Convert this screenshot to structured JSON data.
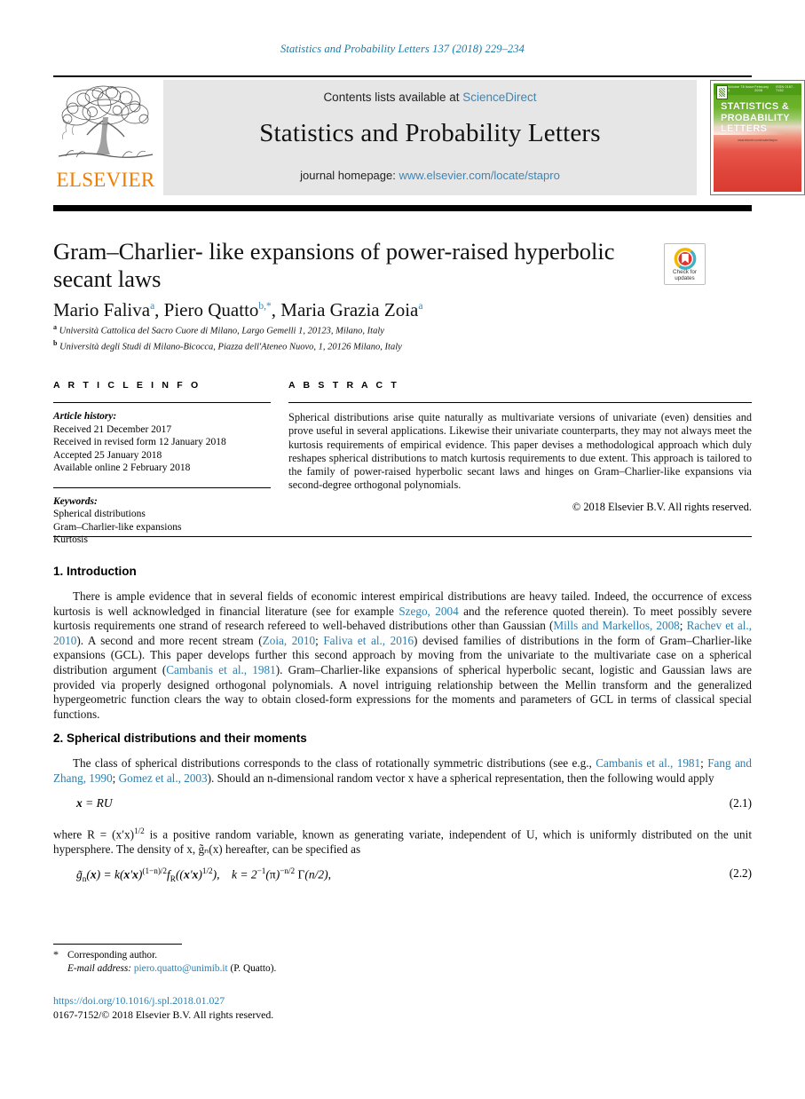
{
  "running_head": "Statistics and Probability Letters 137 (2018) 229–234",
  "header": {
    "contents_prefix": "Contents lists available at ",
    "sciencedirect": "ScienceDirect",
    "journal_title": "Statistics and Probability Letters",
    "homepage_prefix": "journal homepage: ",
    "homepage_url": "www.elsevier.com/locate/stapro",
    "publisher": "ELSEVIER",
    "cover": {
      "title_line1": "STATISTICS &",
      "title_line2": "PROBABILITY",
      "title_line3": "LETTERS",
      "top_left": "Volume 78 Issue 4",
      "top_mid": "February 2008",
      "top_right": "ISSN 0167-7152",
      "caption": "www.elsevier.com/locate/stapro"
    },
    "link_color": "#3d85b5",
    "brand_color": "#f07d00"
  },
  "article": {
    "title": "Gram–Charlier- like expansions of power-raised hyperbolic secant laws",
    "authors": [
      {
        "name": "Mario Faliva",
        "marks": "a"
      },
      {
        "name": "Piero Quatto",
        "marks": "b,*"
      },
      {
        "name": "Maria Grazia Zoia",
        "marks": "a"
      }
    ],
    "affiliations": [
      {
        "mark": "a",
        "text": "Università Cattolica del Sacro Cuore di Milano, Largo Gemelli 1, 20123, Milano, Italy"
      },
      {
        "mark": "b",
        "text": "Università degli Studi di Milano-Bicocca, Piazza dell'Ateneo Nuovo, 1, 20126 Milano, Italy"
      }
    ],
    "crossmark": {
      "line1": "Check for",
      "line2": "updates"
    }
  },
  "article_info": {
    "heading": "A R T I C L E   I N F O",
    "history_label": "Article history:",
    "history": [
      "Received 21 December 2017",
      "Received in revised form 12 January 2018",
      "Accepted 25 January 2018",
      "Available online 2 February 2018"
    ],
    "keywords_label": "Keywords:",
    "keywords": [
      "Spherical distributions",
      "Gram–Charlier-like expansions",
      "Kurtosis"
    ]
  },
  "abstract": {
    "heading": "A B S T R A C T",
    "text": "Spherical distributions arise quite naturally as multivariate versions of univariate (even) densities and prove useful in several applications. Likewise their univariate counterparts, they may not always meet the kurtosis requirements of empirical evidence. This paper devises a methodological approach which duly reshapes spherical distributions to match kurtosis requirements to due extent. This approach is tailored to the family of power-raised hyperbolic secant laws and hinges on Gram–Charlier-like expansions via second-degree orthogonal polynomials.",
    "copyright": "© 2018 Elsevier B.V. All rights reserved."
  },
  "sections": {
    "intro_heading": "1.  Introduction",
    "intro_p1_a": "There is ample evidence that in several fields of economic interest empirical distributions are heavy tailed. Indeed, the occurrence of excess kurtosis is well acknowledged in financial literature (see for example ",
    "intro_ref1": "Szego, 2004",
    "intro_p1_b": " and the reference quoted therein). To meet possibly severe kurtosis requirements one strand of research refereed to well-behaved distributions other than Gaussian (",
    "intro_ref2": "Mills and Markellos, 2008",
    "intro_p1_c": "; ",
    "intro_ref3": "Rachev et al., 2010",
    "intro_p1_d": "). A second and more recent stream (",
    "intro_ref4": "Zoia, 2010",
    "intro_p1_e": "; ",
    "intro_ref5": "Faliva et al., 2016",
    "intro_p1_f": ") devised families of distributions in the form of Gram–Charlier-like expansions (GCL). This paper develops further this second approach by moving from the univariate to the multivariate case on a spherical distribution argument (",
    "intro_ref6": "Cambanis et al., 1981",
    "intro_p1_g": "). Gram–Charlier-like expansions of spherical hyperbolic secant, logistic and Gaussian laws are provided via properly designed orthogonal polynomials. A novel intriguing relationship between the Mellin transform and the generalized hypergeometric function clears the way to obtain closed-form expressions for the moments and parameters of GCL in terms of classical special functions.",
    "sec2_heading": "2.  Spherical distributions and their moments",
    "sec2_p1_a": "The class of spherical distributions corresponds to the class of rotationally symmetric distributions (see e.g., ",
    "sec2_ref1": "Cambanis et al., 1981",
    "sec2_p1_b": "; ",
    "sec2_ref2": "Fang and Zhang, 1990",
    "sec2_p1_c": "; ",
    "sec2_ref3": "Gomez et al., 2003",
    "sec2_p1_d": "). Should an n-dimensional random vector x have a spherical representation, then the following would apply",
    "sec2_p2_a": "where R  =  (x′x)",
    "sec2_p2_b": " is a positive random variable, known as generating variate, independent of U, which is uniformly distributed on the unit hypersphere. The density of x, g̃ₙ(x) hereafter, can be specified as"
  },
  "equations": {
    "eq21_body": "x = RU",
    "eq21_num": "(2.1)",
    "eq22_num": "(2.2)"
  },
  "footer": {
    "corresponding": "Corresponding author.",
    "email_label": "E-mail address:",
    "email": "piero.quatto@unimib.it",
    "email_owner": "(P. Quatto).",
    "doi": "https://doi.org/10.1016/j.spl.2018.01.027",
    "issn_line": "0167-7152/© 2018 Elsevier B.V. All rights reserved."
  }
}
